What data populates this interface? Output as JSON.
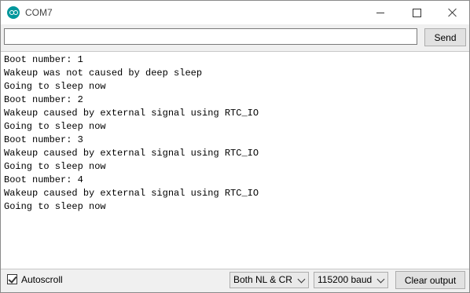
{
  "window": {
    "title": "COM7"
  },
  "send_bar": {
    "input_value": "",
    "send_label": "Send"
  },
  "console": {
    "lines": [
      "Boot number: 1",
      "Wakeup was not caused by deep sleep",
      "Going to sleep now",
      "Boot number: 2",
      "Wakeup caused by external signal using RTC_IO",
      "Going to sleep now",
      "Boot number: 3",
      "Wakeup caused by external signal using RTC_IO",
      "Going to sleep now",
      "Boot number: 4",
      "Wakeup caused by external signal using RTC_IO",
      "Going to sleep now"
    ]
  },
  "footer": {
    "autoscroll_label": "Autoscroll",
    "autoscroll_checked": true,
    "line_ending": "Both NL & CR",
    "baud_rate": "115200 baud",
    "clear_label": "Clear output"
  },
  "colors": {
    "app_icon": "#00979c"
  }
}
